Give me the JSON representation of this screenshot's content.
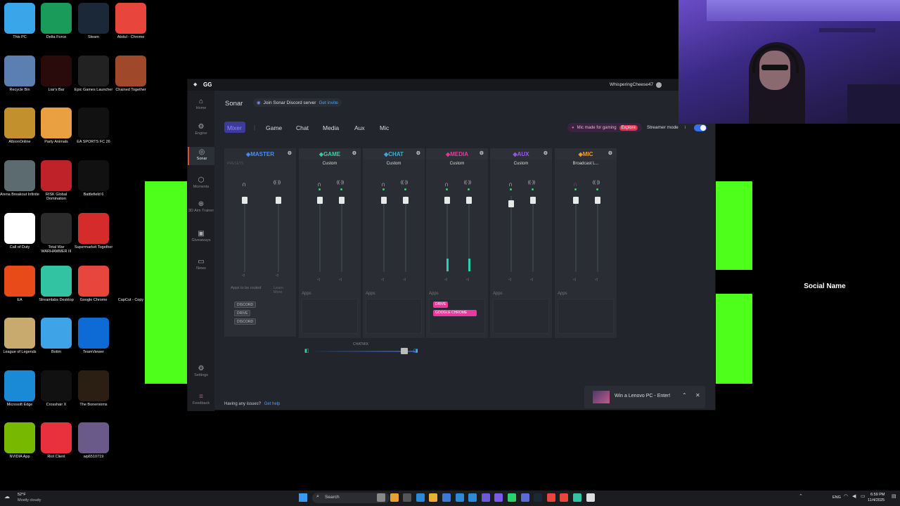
{
  "desktop_icons": [
    {
      "label": "This PC",
      "color": "#38a6e8"
    },
    {
      "label": "Delta Force",
      "color": "#1b9b5a"
    },
    {
      "label": "Steam",
      "color": "#1b2838"
    },
    {
      "label": "Abdul - Chrome",
      "color": "#e8453c"
    },
    {
      "label": "Recycle Bin",
      "color": "#5a7fb0"
    },
    {
      "label": "Liar's Bar",
      "color": "#2a0b0b"
    },
    {
      "label": "Epic Games Launcher",
      "color": "#222222"
    },
    {
      "label": "Chained Together",
      "color": "#a0482a"
    },
    {
      "label": "AlbionOnline",
      "color": "#c2912e"
    },
    {
      "label": "Party Animals",
      "color": "#e8a040"
    },
    {
      "label": "EA SPORTS FC 26",
      "color": "#111111"
    },
    {
      "label": "Arena Breakout Infinite",
      "color": "#5c6b70"
    },
    {
      "label": "RISK Global Domination",
      "color": "#c0222a"
    },
    {
      "label": "Battlefield 6",
      "color": "#111111"
    },
    {
      "label": "Call of Duty",
      "color": "#ffffff"
    },
    {
      "label": "Total War WARHAMMER III",
      "color": "#2b2b2b"
    },
    {
      "label": "Supermarket Together",
      "color": "#d62b2b"
    },
    {
      "label": "EA",
      "color": "#e84a1a"
    },
    {
      "label": "Streamlabs Desktop",
      "color": "#31c3a2"
    },
    {
      "label": "Google Chrome",
      "color": "#e8453c"
    },
    {
      "label": "CapCut - Copy",
      "color": "#000000"
    },
    {
      "label": "League of Legends",
      "color": "#c8aa6e"
    },
    {
      "label": "Botim",
      "color": "#3fa3e8"
    },
    {
      "label": "TeamViewer",
      "color": "#0e6bd6"
    },
    {
      "label": "Microsoft Edge",
      "color": "#1a8ad6"
    },
    {
      "label": "Crosshair X",
      "color": "#111111"
    },
    {
      "label": "The Bonerooms",
      "color": "#2b1e12"
    },
    {
      "label": "NVIDIA App",
      "color": "#76b900"
    },
    {
      "label": "Riot Client",
      "color": "#e8313c"
    },
    {
      "label": "wp6510719",
      "color": "#6a5a8a"
    }
  ],
  "gg": {
    "logo": "GG",
    "user": "WhisperingCheese47",
    "section_title": "Sonar",
    "discord_text": "Join Sonar Discord server",
    "discord_link": "Get invite",
    "tabs": [
      "Mixer",
      "Game",
      "Chat",
      "Media",
      "Aux",
      "Mic"
    ],
    "mic_banner": "Mic made for gaming",
    "mic_banner_link": "Explore",
    "streamer_mode": "Streamer mode",
    "sidebar": [
      {
        "label": "Home",
        "icon": "home-icon"
      },
      {
        "label": "Engine",
        "icon": "engine-icon"
      },
      {
        "label": "Sonar",
        "icon": "sonar-icon"
      },
      {
        "label": "Moments",
        "icon": "moments-icon"
      },
      {
        "label": "3D Aim Trainer",
        "icon": "aim-icon"
      },
      {
        "label": "Giveaways",
        "icon": "gift-icon"
      },
      {
        "label": "News",
        "icon": "news-icon"
      },
      {
        "label": "Settings",
        "icon": "gear-icon"
      },
      {
        "label": "Feedback",
        "icon": "feedback-icon"
      }
    ],
    "channels": [
      {
        "name": "MASTER",
        "color": "#4b8df8",
        "preset": "PRESETS"
      },
      {
        "name": "GAME",
        "color": "#3ad0a0",
        "preset": "Custom"
      },
      {
        "name": "CHAT",
        "color": "#3ab0e8",
        "preset": "Custom"
      },
      {
        "name": "MEDIA",
        "color": "#e83a9a",
        "preset": "Custom"
      },
      {
        "name": "AUX",
        "color": "#9a5ae8",
        "preset": "Custom"
      },
      {
        "name": "MIC",
        "color": "#e8a030",
        "preset": "Broadcast L..."
      }
    ],
    "apps_label": "Apps",
    "master_apps_note": "Apps to be routed",
    "master_learn_more": "Learn More",
    "master_chips": [
      "DISCORD",
      "DRIVE",
      "DISCORD"
    ],
    "media_chips": [
      "DRIVE",
      "GOOGLE CHROME"
    ],
    "chatmix_label": "CHATMIX",
    "help_text": "Having any issues?",
    "help_link": "Get help",
    "toast": "Win a Lenovo PC - Enter!"
  },
  "overlay": {
    "social_name": "Social Name"
  },
  "taskbar": {
    "weather_temp": "52°F",
    "weather_desc": "Mostly cloudy",
    "search_placeholder": "Search",
    "lang": "ENG",
    "time": "6:59 PM",
    "date": "11/4/2025"
  }
}
